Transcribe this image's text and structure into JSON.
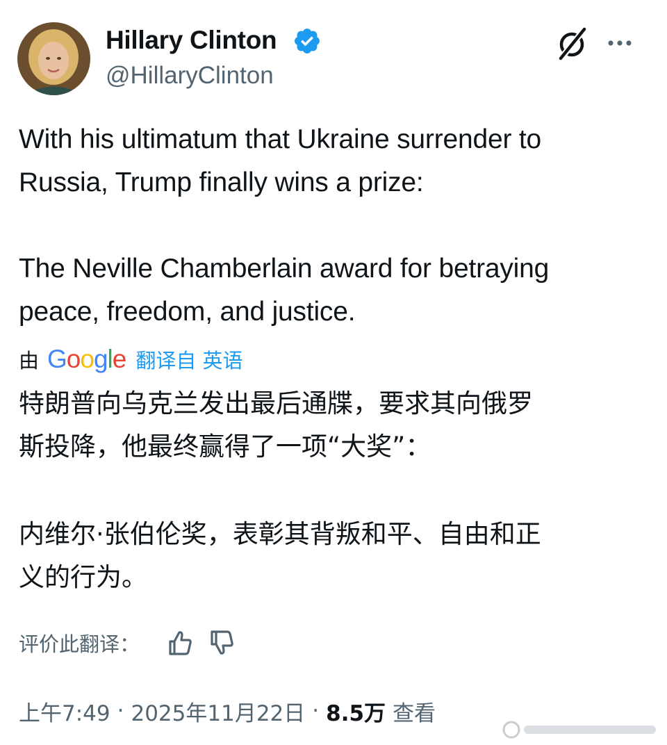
{
  "author": {
    "name": "Hillary Clinton",
    "handle": "@HillaryClinton",
    "verified": true
  },
  "header_actions": {
    "grok_icon": "grok-slash-icon",
    "more_icon": "more-horizontal-icon"
  },
  "tweet": {
    "paragraph1": [
      "With his ultimatum that Ukraine surrender to",
      "Russia, Trump finally wins a prize:"
    ],
    "paragraph2": [
      "The Neville Chamberlain award for betraying",
      "peace, freedom, and justice."
    ]
  },
  "translation": {
    "by_label": "由",
    "provider": "Google",
    "link_text": "翻译自 英语",
    "paragraph1": [
      "特朗普向乌克兰发出最后通牒，要求其向俄罗",
      "斯投降，他最终赢得了一项“大奖”："
    ],
    "paragraph2": [
      "内维尔·张伯伦奖，表彰其背叛和平、自由和正",
      "义的行为。"
    ],
    "rate_label": "评价此翻译："
  },
  "meta": {
    "time": "上午7:49",
    "separator": "·",
    "date": "2025年11月22日",
    "views_count": "8.5万",
    "views_label": "查看"
  },
  "colors": {
    "text": "#0f1419",
    "secondary": "#536471",
    "accent": "#1d9bf0",
    "google_blue": "#4285F4",
    "google_red": "#EA4335",
    "google_yellow": "#FBBC05",
    "google_green": "#34A853"
  }
}
